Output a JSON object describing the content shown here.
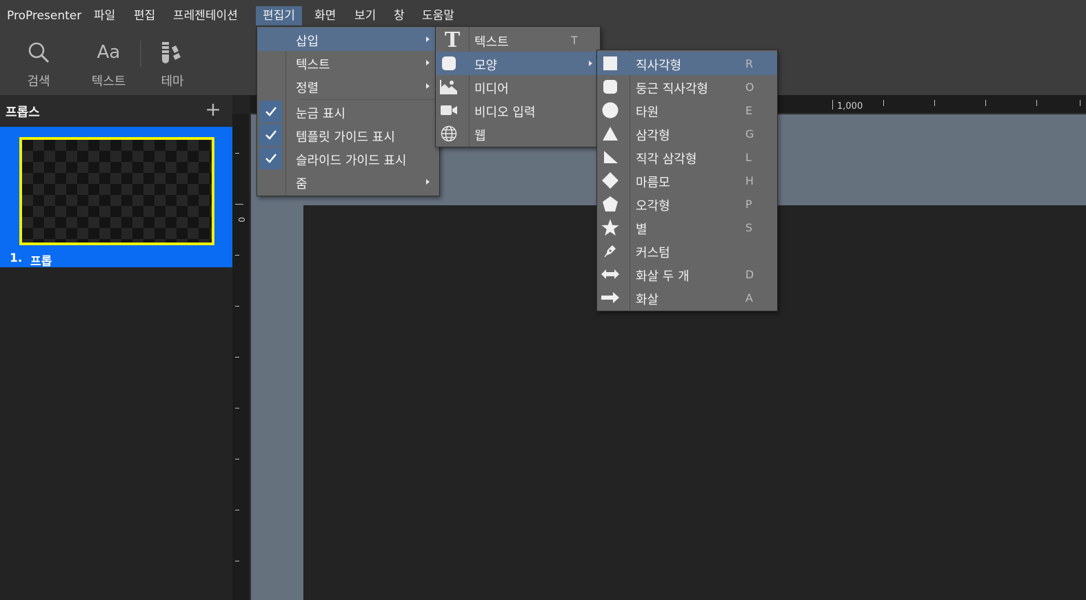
{
  "menubar": {
    "items": [
      "ProPresenter",
      "파일",
      "편집",
      "프레젠테이션",
      "편집기",
      "화면",
      "보기",
      "창",
      "도움말"
    ]
  },
  "toolbar": {
    "search_label": "검색",
    "text_label": "텍스트",
    "text_icon_glyph": "Aa",
    "theme_label": "테마"
  },
  "props_panel": {
    "title": "프롭스",
    "add_symbol": "+",
    "item_number": "1.",
    "item_name": "프롭"
  },
  "ruler": {
    "h_label": "1,000",
    "v_label": "0"
  },
  "editor_menu": {
    "items": [
      {
        "label": "삽입",
        "submenu": true
      },
      {
        "label": "텍스트",
        "submenu": true
      },
      {
        "label": "정렬",
        "submenu": true
      },
      {
        "label": "눈금 표시",
        "checked": true
      },
      {
        "label": "템플릿 가이드 표시",
        "checked": true
      },
      {
        "label": "슬라이드 가이드 표시",
        "checked": true
      },
      {
        "label": "줌",
        "submenu": true
      }
    ]
  },
  "insert_menu": {
    "items": [
      {
        "label": "텍스트",
        "shortcut": "T",
        "icon": "text-T-icon"
      },
      {
        "label": "모양",
        "submenu": true,
        "icon": "shape-icon"
      },
      {
        "label": "미디어",
        "icon": "media-icon"
      },
      {
        "label": "비디오 입력",
        "icon": "video-camera-icon"
      },
      {
        "label": "웹",
        "icon": "globe-icon"
      }
    ]
  },
  "shape_menu": {
    "items": [
      {
        "label": "직사각형",
        "shortcut": "R",
        "icon": "rectangle-icon"
      },
      {
        "label": "둥근 직사각형",
        "shortcut": "O",
        "icon": "rounded-rectangle-icon"
      },
      {
        "label": "타원",
        "shortcut": "E",
        "icon": "ellipse-icon"
      },
      {
        "label": "삼각형",
        "shortcut": "G",
        "icon": "triangle-icon"
      },
      {
        "label": "직각 삼각형",
        "shortcut": "L",
        "icon": "right-triangle-icon"
      },
      {
        "label": "마름모",
        "shortcut": "H",
        "icon": "diamond-icon"
      },
      {
        "label": "오각형",
        "shortcut": "P",
        "icon": "pentagon-icon"
      },
      {
        "label": "별",
        "shortcut": "S",
        "icon": "star-icon"
      },
      {
        "label": "커스텀",
        "shortcut": "",
        "icon": "pen-icon"
      },
      {
        "label": "화살 두 개",
        "shortcut": "D",
        "icon": "double-arrow-icon"
      },
      {
        "label": "화살",
        "shortcut": "A",
        "icon": "arrow-icon"
      }
    ]
  },
  "colors": {
    "selection_blue": "#0a6cf2",
    "thumbnail_border": "#f2f200",
    "menu_highlight": "#576f8f"
  }
}
